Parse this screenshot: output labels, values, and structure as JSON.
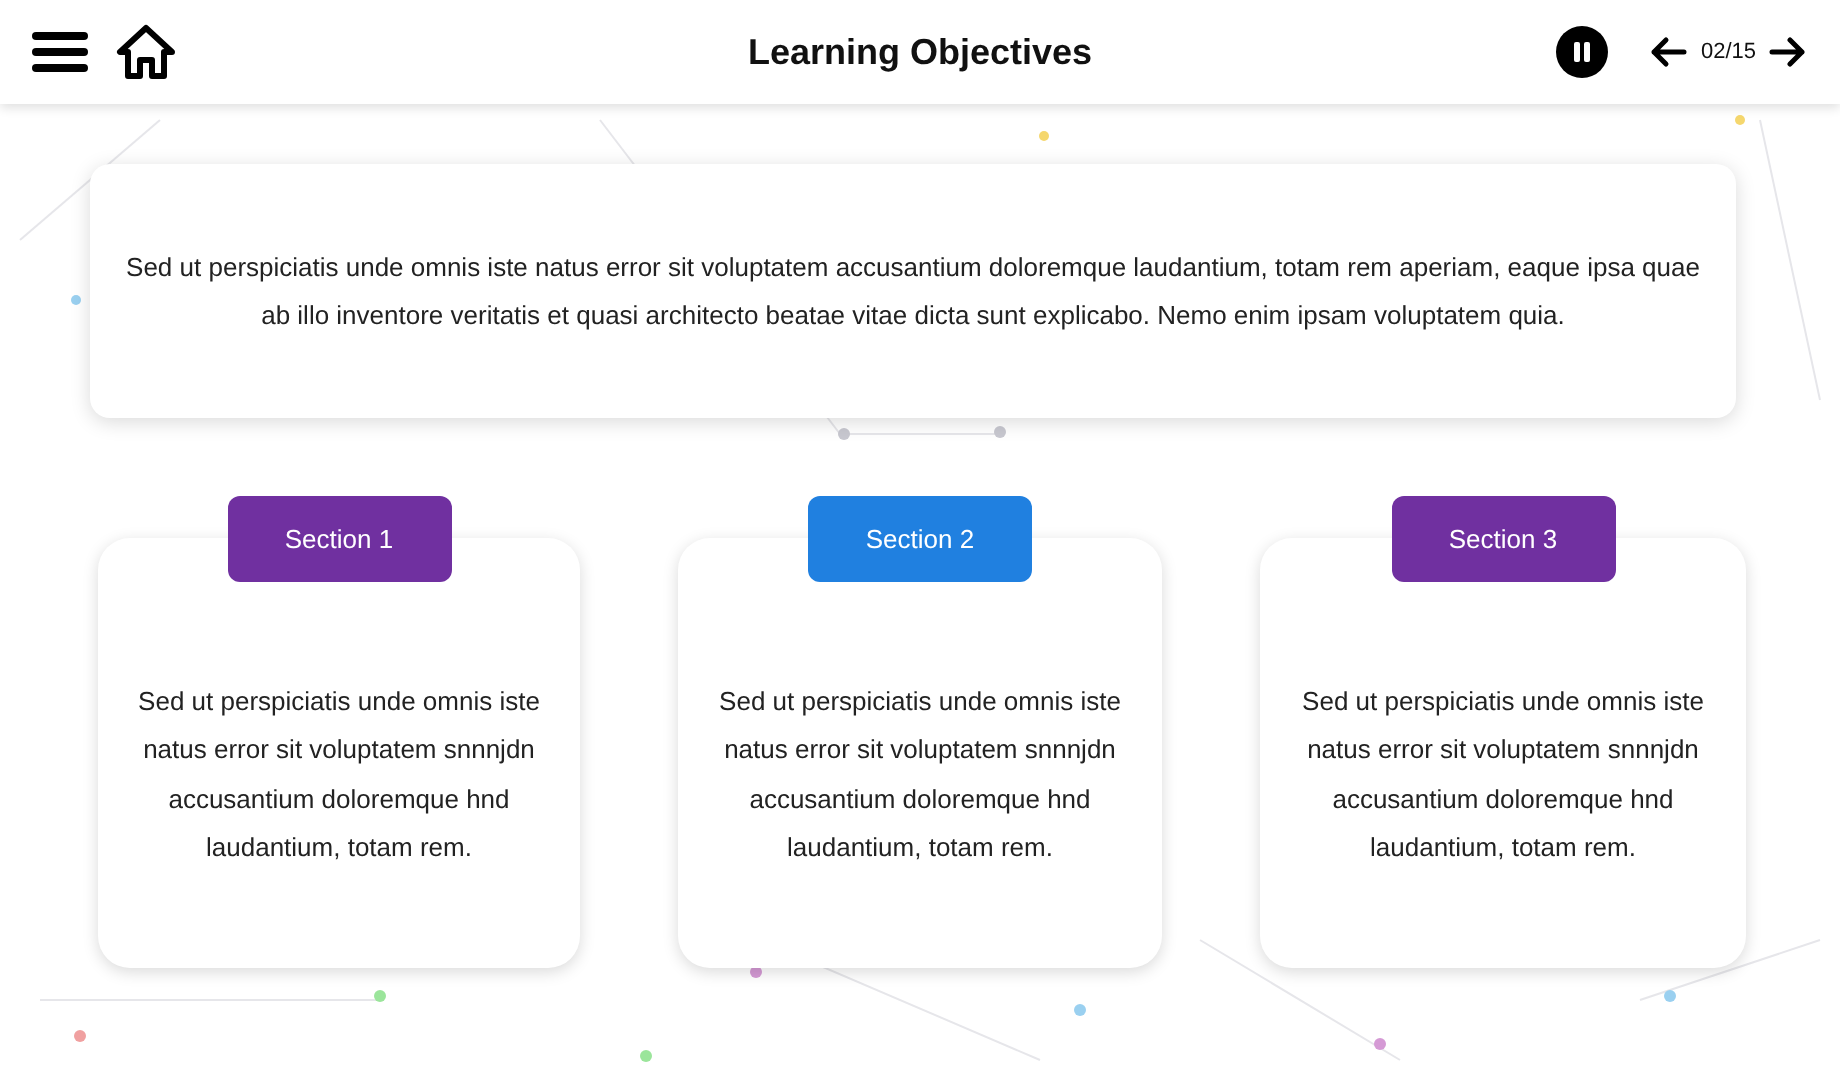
{
  "header": {
    "title": "Learning Objectives",
    "page": "02/15"
  },
  "intro": "Sed ut perspiciatis unde omnis iste natus error sit voluptatem accusantium doloremque laudantium, totam rem aperiam, eaque ipsa quae ab illo inventore veritatis et quasi architecto beatae vitae dicta sunt explicabo. Nemo enim ipsam voluptatem quia.",
  "sections": [
    {
      "label": "Section 1",
      "color": "#7030a0",
      "text": "Sed ut perspiciatis unde omnis iste natus error sit voluptatem snnnjdn accusantium doloremque hnd laudantium, totam rem."
    },
    {
      "label": "Section 2",
      "color": "#2080e0",
      "text": "Sed ut perspiciatis unde omnis iste natus error sit voluptatem snnnjdn accusantium doloremque hnd laudantium, totam rem."
    },
    {
      "label": "Section 3",
      "color": "#7030a0",
      "text": "Sed ut perspiciatis unde omnis iste natus error sit voluptatem snnnjdn accusantium doloremque hnd laudantium, totam rem."
    }
  ]
}
